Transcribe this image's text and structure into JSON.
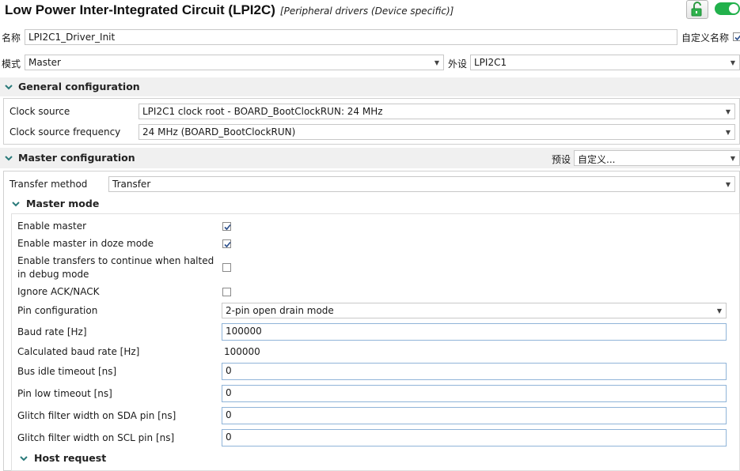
{
  "header": {
    "title": "Low Power Inter-Integrated Circuit (LPI2C)",
    "subtitle": "[Peripheral drivers (Device specific)]",
    "lock_icon": "unlock-icon",
    "toggle_state": "on",
    "toggle_color": "#22b14c"
  },
  "name_row": {
    "label": "名称",
    "value": "LPI2C1_Driver_Init",
    "custom_name_label": "自定义名称",
    "custom_name_checked": true
  },
  "mode_row": {
    "mode_label": "模式",
    "mode_value": "Master",
    "peripheral_label": "外设",
    "peripheral_value": "LPI2C1"
  },
  "general": {
    "title": "General configuration",
    "clock_source_label": "Clock source",
    "clock_source_value": "LPI2C1 clock root - BOARD_BootClockRUN: 24 MHz",
    "clock_freq_label": "Clock source frequency",
    "clock_freq_value": "24 MHz (BOARD_BootClockRUN)"
  },
  "master": {
    "title": "Master configuration",
    "preset_label": "预设",
    "preset_value": "自定义...",
    "transfer_method_label": "Transfer method",
    "transfer_method_value": "Transfer",
    "mode_title": "Master mode",
    "enable_master_label": "Enable master",
    "enable_master_checked": true,
    "doze_label": "Enable master in doze mode",
    "doze_checked": true,
    "debug_label_line1": "Enable transfers to continue when halted",
    "debug_label_line2": "in debug mode",
    "debug_checked": false,
    "ignore_ack_label": "Ignore ACK/NACK",
    "ignore_ack_checked": false,
    "pin_config_label": "Pin configuration",
    "pin_config_value": "2-pin open drain mode",
    "baud_label": "Baud rate [Hz]",
    "baud_value": "100000",
    "calc_baud_label": "Calculated baud rate [Hz]",
    "calc_baud_value": "100000",
    "bus_idle_label": "Bus idle timeout [ns]",
    "bus_idle_value": "0",
    "pin_low_label": "Pin low timeout [ns]",
    "pin_low_value": "0",
    "sda_label": "Glitch filter width on SDA pin [ns]",
    "sda_value": "0",
    "scl_label": "Glitch filter width on SCL pin [ns]",
    "scl_value": "0",
    "host_request_title": "Host request"
  }
}
